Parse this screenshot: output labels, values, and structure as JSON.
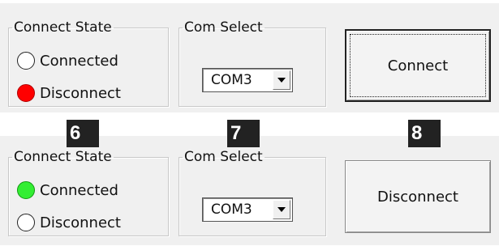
{
  "panels": [
    {
      "connect_state": {
        "legend": "Connect State",
        "options": [
          {
            "label": "Connected",
            "indicator_color": "#ffffff"
          },
          {
            "label": "Disconnect",
            "indicator_color": "#ff0000"
          }
        ]
      },
      "com_select": {
        "legend": "Com Select",
        "value": "COM3"
      },
      "button_label": "Connect"
    },
    {
      "connect_state": {
        "legend": "Connect State",
        "options": [
          {
            "label": "Connected",
            "indicator_color": "#33ee33"
          },
          {
            "label": "Disconnect",
            "indicator_color": "#ffffff"
          }
        ]
      },
      "com_select": {
        "legend": "Com Select",
        "value": "COM3"
      },
      "button_label": "Disconnect"
    }
  ],
  "tags": [
    "6",
    "7",
    "8"
  ]
}
